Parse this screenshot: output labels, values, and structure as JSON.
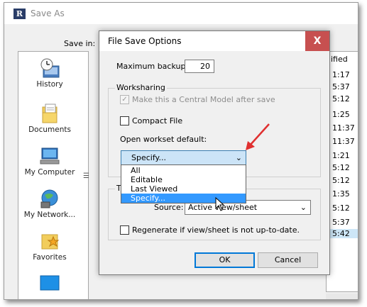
{
  "save_as": {
    "title": "Save As",
    "save_in_label": "Save in:",
    "places": [
      {
        "label": "History",
        "icon": "history-icon"
      },
      {
        "label": "Documents",
        "icon": "documents-icon"
      },
      {
        "label": "My Computer",
        "icon": "computer-icon"
      },
      {
        "label": "My Network...",
        "icon": "network-icon"
      },
      {
        "label": "Favorites",
        "icon": "favorites-icon"
      }
    ],
    "list_header": "ified",
    "times": [
      "1:17",
      "5:37",
      "5:12",
      "1:25",
      "11:37",
      "11:37",
      "1:21",
      "5:12",
      "5:12",
      "1:35",
      "5:12",
      "5:37",
      "5:42"
    ]
  },
  "dialog": {
    "title": "File Save Options",
    "max_backups_label": "Maximum backups:",
    "max_backups_value": "20",
    "worksharing_group": "Worksharing",
    "central_model_label": "Make this a Central Model after save",
    "compact_file_label": "Compact File",
    "open_workset_label": "Open workset default:",
    "workset_selected": "Specify...",
    "workset_options": [
      "All",
      "Editable",
      "Last Viewed",
      "Specify..."
    ],
    "thumbnail_group_partial": "T",
    "source_label": "Source:",
    "source_value": "Active view/sheet",
    "regenerate_label": "Regenerate if view/sheet is not up-to-date.",
    "ok_label": "OK",
    "cancel_label": "Cancel",
    "close_glyph": "X"
  },
  "colors": {
    "close_button": "#c75050",
    "selection": "#3399ff",
    "combo_focus": "#cce4f7",
    "annotation_arrow": "#e03030"
  }
}
